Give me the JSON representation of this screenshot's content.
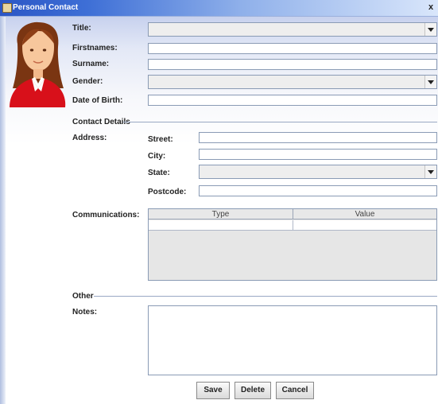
{
  "window": {
    "title": "Personal Contact",
    "close_glyph": "x"
  },
  "person": {
    "title_label": "Title:",
    "firstnames_label": "Firstnames:",
    "surname_label": "Surname:",
    "gender_label": "Gender:",
    "dob_label": "Date of Birth:",
    "title_value": "",
    "firstnames_value": "",
    "surname_value": "",
    "gender_value": "",
    "dob_value": ""
  },
  "contact": {
    "section_label": "Contact Details",
    "address_label": "Address:",
    "street_label": "Street:",
    "city_label": "City:",
    "state_label": "State:",
    "postcode_label": "Postcode:",
    "street_value": "",
    "city_value": "",
    "state_value": "",
    "postcode_value": ""
  },
  "communications": {
    "label": "Communications:",
    "columns": [
      "Type",
      "Value"
    ]
  },
  "other": {
    "section_label": "Other",
    "notes_label": "Notes:",
    "notes_value": ""
  },
  "buttons": {
    "save": "Save",
    "delete": "Delete",
    "cancel": "Cancel"
  },
  "icons": {
    "avatar": "female-user-avatar-icon",
    "window": "java-cup-icon"
  }
}
